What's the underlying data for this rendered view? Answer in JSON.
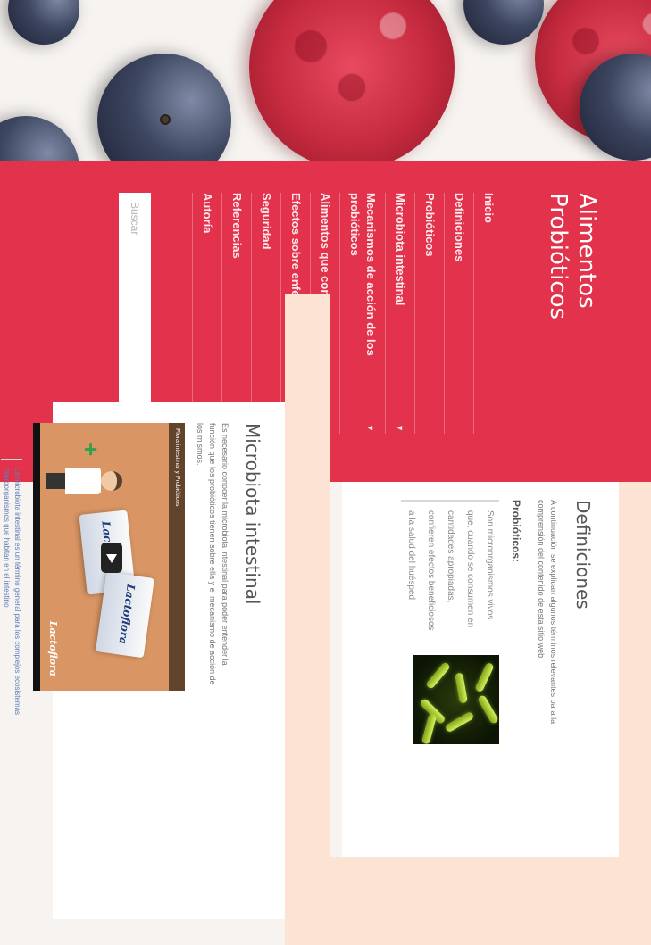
{
  "site": {
    "title": "Alimentos Probióticos"
  },
  "nav": {
    "items": [
      {
        "label": "Inicio",
        "has_submenu": false
      },
      {
        "label": "Definiciones",
        "has_submenu": false
      },
      {
        "label": "Probióticos",
        "has_submenu": false
      },
      {
        "label": "Microbiota intestinal",
        "has_submenu": true
      },
      {
        "label": "Mecanismos de acción de los probióticos",
        "has_submenu": true
      },
      {
        "label": "Alimentos que contienen probióticos",
        "has_submenu": false
      },
      {
        "label": "Efectos sobre enfermedades",
        "has_submenu": true
      },
      {
        "label": "Seguridad",
        "has_submenu": false
      },
      {
        "label": "Referencias",
        "has_submenu": true
      },
      {
        "label": "Autoría",
        "has_submenu": false
      }
    ],
    "submenu_icon": "chevron-down-icon"
  },
  "search": {
    "placeholder": "Buscar",
    "value": ""
  },
  "definiciones": {
    "title": "Definiciones",
    "intro": "A continuación se explican algunos términos relevantes para la comprensión del contenido de esta sitio web",
    "subtitle": "Probióticos:",
    "quote": "Son microorganismos vivos que, cuando se consumen en cantidades apropiadas, confieren efectos beneficiosos a la salud del huésped."
  },
  "microbiota": {
    "title": "Microbiota intestinal",
    "intro": "Es necesario conocer la microbiota intestinal para poder entender la función que los probióticos tienen sobre ella y el mecanismo de acción de los mismos.",
    "video": {
      "title": "Flora intestinal y Probióticos",
      "brand": "Lactoflora"
    },
    "quote": "La microbiota intestinal es un término general para los complejos ecosistemas microorganismos que habitan en el intestino"
  },
  "colors": {
    "sidebar": "#e2324c",
    "peach": "#fce3d4",
    "text": "#555555",
    "link_blue": "#5b7fbe"
  }
}
